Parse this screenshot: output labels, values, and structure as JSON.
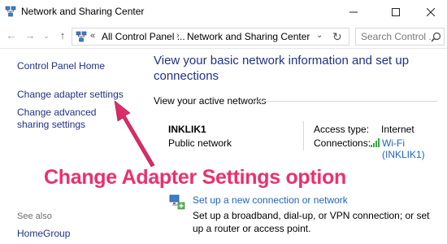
{
  "window": {
    "title": "Network and Sharing Center"
  },
  "addressbar": {
    "overflow": "«",
    "crumb1": "All Control Panel ...",
    "separator": "›",
    "crumb2": "Network and Sharing Center",
    "search_placeholder": "Search Control ..."
  },
  "sidebar": {
    "home": "Control Panel Home",
    "adapter": "Change adapter settings",
    "sharing": "Change advanced sharing settings",
    "see_also": "See also",
    "homegroup": "HomeGroup"
  },
  "main": {
    "title": "View your basic network information and set up connections",
    "active_networks_label": "View your active networks",
    "network_name": "INKLIK1",
    "network_type": "Public network",
    "access_type_label": "Access type:",
    "access_type_value": "Internet",
    "connections_label": "Connections:",
    "connections_value": "Wi-Fi (INKLIK1)",
    "section_fragment": "Ch",
    "setup_link": "Set up a new connection or network",
    "setup_description": "Set up a broadband, dial-up, or VPN connection; or set up a router or access point."
  },
  "annotation": {
    "text": "Change Adapter Settings option",
    "color": "#ed2f6d"
  },
  "colors": {
    "link": "#1e3287",
    "link_light": "#1e64c8",
    "wifi_green": "#3aa646"
  },
  "icons": [
    "network-center-icon",
    "back-arrow-icon",
    "forward-arrow-icon",
    "up-arrow-icon",
    "refresh-icon",
    "search-icon",
    "wifi-signal-icon",
    "setup-connection-icon"
  ]
}
